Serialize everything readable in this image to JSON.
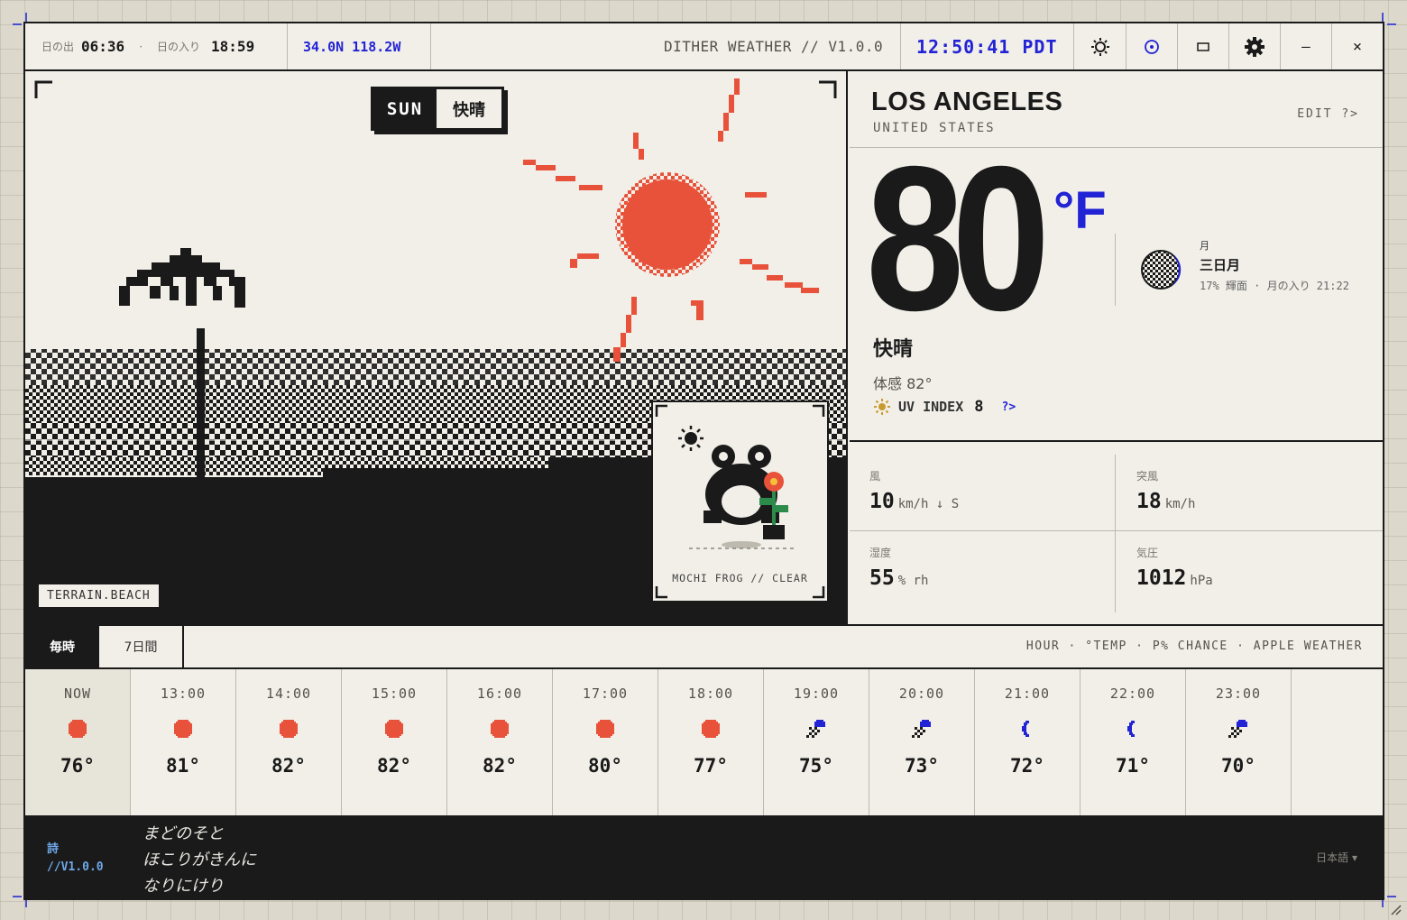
{
  "topbar": {
    "sunrise_label": "日の出",
    "sunrise_time": "06:36",
    "dot": "·",
    "sunset_label": "日の入り",
    "sunset_time": "18:59",
    "coords": "34.0N 118.2W",
    "app_title": "DITHER WEATHER // V1.0.0",
    "clock": "12:50:41 PDT",
    "icons": [
      "sun-icon",
      "location-target-icon",
      "window-icon",
      "gear-icon",
      "minimize-icon",
      "close-icon"
    ],
    "minimize_glyph": "–",
    "close_glyph": "×"
  },
  "scene": {
    "day_en": "SUN",
    "day_jp": "快晴",
    "terrain": "TERRAIN.BEACH",
    "pet_caption": "MOCHI FROG // CLEAR"
  },
  "location": {
    "city": "LOS ANGELES",
    "country": "UNITED STATES",
    "edit": "EDIT ?>"
  },
  "current": {
    "temp": "80",
    "unit": "°F",
    "condition": "快晴",
    "feels_like": "体感 82°",
    "uv_label": "UV INDEX",
    "uv_value": "8",
    "uv_help": "?>"
  },
  "moon": {
    "label": "月",
    "phase": "三日月",
    "detail": "17% 輝面 · 月の入り 21:22"
  },
  "stats": {
    "wind": {
      "label": "風",
      "value": "10",
      "unit": "km/h ↓ S"
    },
    "gust": {
      "label": "突風",
      "value": "18",
      "unit": "km/h"
    },
    "humidity": {
      "label": "湿度",
      "value": "55",
      "unit": "% rh"
    },
    "pressure": {
      "label": "気圧",
      "value": "1012",
      "unit": "hPa"
    }
  },
  "tabs": {
    "hourly": "毎時",
    "seven_day": "7日間",
    "legend": "HOUR · °TEMP · P% CHANCE · APPLE WEATHER"
  },
  "hourly": [
    {
      "time": "NOW",
      "icon": "sun",
      "temp": "76°"
    },
    {
      "time": "13:00",
      "icon": "sun",
      "temp": "81°"
    },
    {
      "time": "14:00",
      "icon": "sun",
      "temp": "82°"
    },
    {
      "time": "15:00",
      "icon": "sun",
      "temp": "82°"
    },
    {
      "time": "16:00",
      "icon": "sun",
      "temp": "82°"
    },
    {
      "time": "17:00",
      "icon": "sun",
      "temp": "80°"
    },
    {
      "time": "18:00",
      "icon": "sun",
      "temp": "77°"
    },
    {
      "time": "19:00",
      "icon": "night-cloud",
      "temp": "75°"
    },
    {
      "time": "20:00",
      "icon": "night-cloud",
      "temp": "73°"
    },
    {
      "time": "21:00",
      "icon": "moon",
      "temp": "72°"
    },
    {
      "time": "22:00",
      "icon": "moon",
      "temp": "71°"
    },
    {
      "time": "23:00",
      "icon": "night-cloud",
      "temp": "70°"
    }
  ],
  "footer": {
    "poem_tag": "詩",
    "version": "//V1.0.0",
    "poem": [
      "まどのそと",
      "ほこりがきんに",
      "なりにけり"
    ],
    "language": "日本語 ▾"
  },
  "colors": {
    "accent_blue": "#2323d6",
    "sun_red": "#e8523a",
    "ink": "#1a1a1a",
    "paper": "#f1efe8"
  }
}
